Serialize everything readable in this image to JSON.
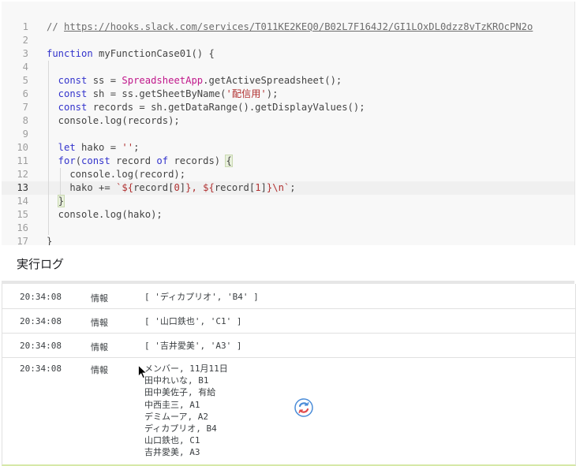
{
  "editor": {
    "lines": [
      {
        "n": "1",
        "tokens": [
          {
            "t": "// ",
            "c": "t-cm"
          },
          {
            "t": "https://hooks.slack.com/services/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",
            "c": "t-url"
          }
        ]
      },
      {
        "n": "2",
        "tokens": []
      },
      {
        "n": "3",
        "tokens": [
          {
            "t": "function",
            "c": "t-kw"
          },
          {
            "t": " myFunctionCase01() {",
            "c": ""
          }
        ]
      },
      {
        "n": "4",
        "tokens": []
      },
      {
        "n": "5",
        "tokens": [
          {
            "t": "  const",
            "c": "t-kw"
          },
          {
            "t": " ss = ",
            "c": ""
          },
          {
            "t": "SpreadsheetApp",
            "c": "t-cls"
          },
          {
            "t": ".getActiveSpreadsheet();",
            "c": ""
          }
        ]
      },
      {
        "n": "6",
        "tokens": [
          {
            "t": "  const",
            "c": "t-kw"
          },
          {
            "t": " sh = ss.getSheetByName(",
            "c": ""
          },
          {
            "t": "'配信用'",
            "c": "t-str"
          },
          {
            "t": ");",
            "c": ""
          }
        ]
      },
      {
        "n": "7",
        "tokens": [
          {
            "t": "  const",
            "c": "t-kw"
          },
          {
            "t": " records = sh.getDataRange().getDisplayValues();",
            "c": ""
          }
        ]
      },
      {
        "n": "8",
        "tokens": [
          {
            "t": "  console.log(records);",
            "c": ""
          }
        ]
      },
      {
        "n": "9",
        "tokens": []
      },
      {
        "n": "10",
        "tokens": [
          {
            "t": "  let",
            "c": "t-kw"
          },
          {
            "t": " hako = ",
            "c": ""
          },
          {
            "t": "''",
            "c": "t-str"
          },
          {
            "t": ";",
            "c": ""
          }
        ]
      },
      {
        "n": "11",
        "tokens": [
          {
            "t": "  for",
            "c": "t-kw"
          },
          {
            "t": "(",
            "c": ""
          },
          {
            "t": "const",
            "c": "t-kw"
          },
          {
            "t": " record ",
            "c": ""
          },
          {
            "t": "of",
            "c": "t-kw"
          },
          {
            "t": " records) ",
            "c": ""
          },
          {
            "t": "{",
            "c": "t-br"
          }
        ]
      },
      {
        "n": "12",
        "tokens": [
          {
            "t": "    console.log(record);",
            "c": ""
          }
        ]
      },
      {
        "n": "13",
        "tokens": [
          {
            "t": "    hako += ",
            "c": ""
          },
          {
            "t": "`${",
            "c": "t-str"
          },
          {
            "t": "record[",
            "c": ""
          },
          {
            "t": "0",
            "c": "t-str"
          },
          {
            "t": "]",
            "c": ""
          },
          {
            "t": "}, ${",
            "c": "t-str"
          },
          {
            "t": "record[",
            "c": ""
          },
          {
            "t": "1",
            "c": "t-str"
          },
          {
            "t": "]",
            "c": ""
          },
          {
            "t": "}\\n`",
            "c": "t-str"
          },
          {
            "t": ";",
            "c": ""
          }
        ]
      },
      {
        "n": "14",
        "tokens": [
          {
            "t": "  ",
            "c": ""
          },
          {
            "t": "}",
            "c": "t-br"
          }
        ]
      },
      {
        "n": "15",
        "tokens": [
          {
            "t": "  console.log(hako);",
            "c": ""
          }
        ]
      },
      {
        "n": "16",
        "tokens": []
      },
      {
        "n": "17",
        "tokens": [
          {
            "t": "}",
            "c": ""
          }
        ]
      }
    ],
    "active_line": 13
  },
  "log": {
    "title": "実行ログ",
    "entries": [
      {
        "time": "20:34:08",
        "level": "情報",
        "lines": [
          "[ 'ディカプリオ', 'B4' ]"
        ]
      },
      {
        "time": "20:34:08",
        "level": "情報",
        "lines": [
          "[ '山口鉄也', 'C1' ]"
        ]
      },
      {
        "time": "20:34:08",
        "level": "情報",
        "lines": [
          "[ '吉井愛美', 'A3' ]"
        ]
      },
      {
        "time": "20:34:08",
        "level": "情報",
        "lines": [
          "メンバー, 11月11日",
          "田中れいな, B1",
          "田中美佐子, 有給",
          "中西圭三, A1",
          "デミムーア, A2",
          "ディカプリオ, B4",
          "山口鉄也, C1",
          "吉井愛美, A3"
        ]
      }
    ]
  },
  "icons": {
    "cursor": "mouse-pointer-icon",
    "spinner": "loading-spinner-icon"
  },
  "colors": {
    "keyword": "#3333cc",
    "string": "#b03030",
    "class": "#c0188b",
    "spinner": "#4a8cd8"
  }
}
